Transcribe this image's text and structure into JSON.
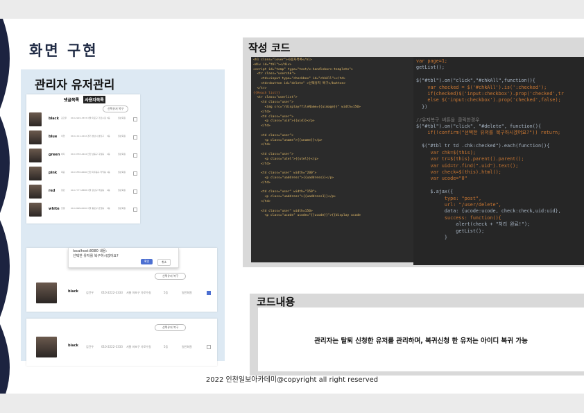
{
  "title": "화면 구현",
  "panel": {
    "title": "관리자 유저관리",
    "tabs": [
      "댓글목록",
      "사용자목록"
    ],
    "restore_button": "선택유저 복구",
    "rows": [
      {
        "uid": "black",
        "name": "김건우",
        "tel": "010-2222-3333",
        "addr": "서울 마포구 가로수길",
        "grade": "5등",
        "note": "일반회원"
      },
      {
        "uid": "blue",
        "name": "이현",
        "tel": "010-1111-2222",
        "addr": "경기 성남시 분당구",
        "grade": "3등",
        "note": "일반회원"
      },
      {
        "uid": "green",
        "name": "박지",
        "tel": "010-3333-4444",
        "addr": "인천 남동구 구월동",
        "grade": "2등",
        "note": "일반회원"
      },
      {
        "uid": "pink",
        "name": "최윤",
        "tel": "010-5555-6666",
        "addr": "인천 미추홀구 학익동",
        "grade": "1등",
        "note": "일반회원"
      },
      {
        "uid": "red",
        "name": "정민",
        "tel": "010-7777-8888",
        "addr": "서울 강남구 역삼동",
        "grade": "4등",
        "note": "일반회원"
      },
      {
        "uid": "white",
        "name": "한결",
        "tel": "010-9999-0000",
        "addr": "서울 종로구 관철동",
        "grade": "3등",
        "note": "일반회원"
      }
    ],
    "dialog_host": "localhost:8080 내용:",
    "dialog_msg": "선택한 유저를 복구하시겠어요?",
    "dialog_ok": "확인",
    "dialog_cancel": "취소",
    "detail_row": {
      "uid": "black",
      "name": "김건우",
      "tel": "010-2222-3333",
      "addr": "서울 마포구 가로수길",
      "grade": "5등",
      "note": "일반회원"
    }
  },
  "code_section_title": "작성 코드",
  "code_left": [
    "<h1 class=\"lover\">사용자목록</h1>",
    "<div id=\"tbl\"></div>",
    "<script id=\"temp\" type=\"text/x-handlebars-template\">",
    "  <tr class=\"userchk\">",
    "    <td><input type=\"checkbox\" id=\"chkAll\"></td>",
    "    <td><button id=\"delete\" >선택유저 복구</button>",
    "  </tr>",
    "{{#each list}}",
    "  <tr class=\"userlist\">",
    "    <td class=\"user\">",
    "      <img src=\"/display?fileName={{uimage}}\" width=150>",
    "    </td>",
    "    <td class=\"user\">",
    "      <p class=\"uid\">{{uid}}</p>",
    "    </td>",
    "",
    "    <td class=\"user\">",
    "      <p class=\"uname\">{{uname}}</p>",
    "    </td>",
    "",
    "    <td class=\"user\">",
    "      <p class=\"utel\">{{utel}}</p>",
    "    </td>",
    "",
    "    <td class=\"user\" width=\"200\">",
    "      <p class=\"uaddress\">{{uaddress}}</p>",
    "    </td>",
    "",
    "    <td class=\"user\" width=\"150\">",
    "      <p class=\"uaddress\">{{uaddress1}}</p>",
    "    </td>",
    "",
    "    <td class=\"user\" width=150>",
    "      <p class=\"ucode\" ucode=\"{{ucode}}\">{{display ucode"
  ],
  "code_right": [
    "var page=1;",
    "getList();",
    "",
    "$(\"#tbl\").on(\"click\",\"#chkAll\",function(){",
    "    var checked = $('#chkAll').is(':checked');",
    "    if(checked)$('input:checkbox').prop('checked',tr",
    "    else $('input:checkbox').prop('checked',false);",
    "  })",
    "",
    "//유저복구 버튼을 클릭한경우",
    "$(\"#tbl\").on(\"click\", \"#delete\", function(){",
    "    if(!confirm(\"선택한 유저를 복구하시겠어요?\")) return;",
    "",
    "  $(\"#tbl tr td .chk:checked\").each(function(){",
    "     var chk=$(this);",
    "     var tr=$(this).parent().parent();",
    "     var uid=tr.find(\".uid\").text();",
    "     var check=$(this).html();",
    "     var ucode=\"0\"",
    "",
    "     $.ajax({",
    "          type: \"post\",",
    "          url: \"/user/delete\",",
    "          data: {ucode:ucode, check:check,uid:uid},",
    "          success: function(){",
    "              alert(check + \"처리 완료!\");",
    "              getList();",
    "          }"
  ],
  "content_section_title": "코드내용",
  "content_text": "관리자는 탈퇴 신청한 유저를 관리하며, 복귀신청 한 유저는 아이디 복귀 가능",
  "footer": "2022 인천일보아카데미@copyright all right reserved"
}
